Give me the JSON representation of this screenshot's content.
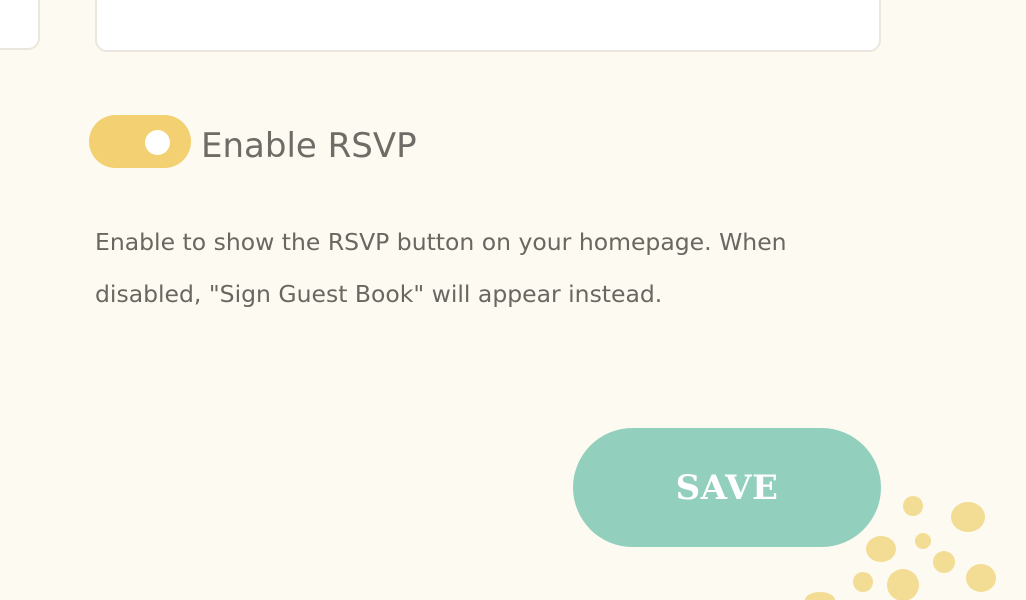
{
  "rsvp": {
    "toggle_label": "Enable RSVP",
    "toggle_state": "on",
    "help_text": "Enable to show the RSVP button on your homepage. When disabled, \"Sign Guest Book\" will appear instead."
  },
  "actions": {
    "save_label": "SAVE"
  },
  "colors": {
    "background": "#fdfaf1",
    "toggle_on": "#f3d173",
    "save_button": "#92d0bd",
    "decor_dots": "#f3dd94",
    "text": "#6f6b66"
  }
}
